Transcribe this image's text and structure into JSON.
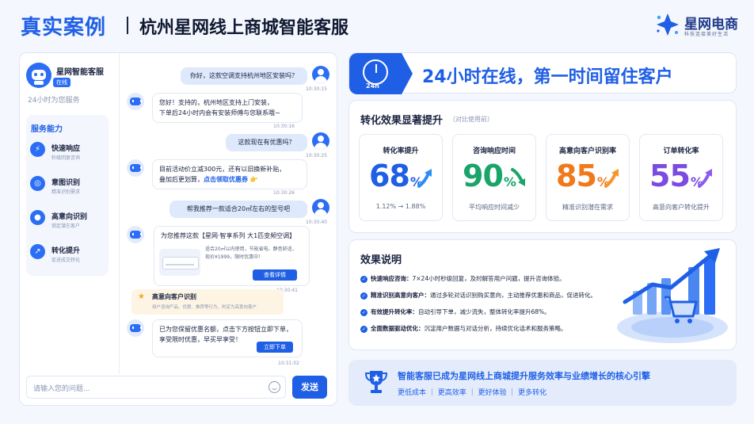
{
  "header": {
    "title_left": "真实案例",
    "title_right": "杭州星网线上商城智能客服"
  },
  "logo": {
    "name": "星网电商",
    "slogan": "科技连接美好生活"
  },
  "chat": {
    "bot_name": "星网智能客服",
    "status": "在线",
    "service_note": "24小时为您服务",
    "abilities_title": "服务能力",
    "abilities": [
      {
        "name": "快速响应",
        "desc": "秒级回复咨询",
        "icon": "lightning-icon"
      },
      {
        "name": "意图识别",
        "desc": "精准识别需求",
        "icon": "target-icon"
      },
      {
        "name": "高意向识别",
        "desc": "锁定潜在客户",
        "icon": "user-icon"
      },
      {
        "name": "转化提升",
        "desc": "促进成交转化",
        "icon": "growth-chart-icon"
      }
    ],
    "messages": {
      "m1": {
        "text": "你好，这款空调支持杭州地区安装吗？",
        "time": "10:30:15"
      },
      "m2": {
        "line1": "您好！支持的，杭州地区支持上门安装，",
        "line2": "下单后24小时内会有安装师傅与您联系哦~",
        "time": "10:30:16"
      },
      "m3": {
        "text": "这款现在有优惠吗？",
        "time": "10:30:25"
      },
      "m4": {
        "line1": "目前活动价立减300元，还有以旧换新补贴，",
        "line2_pre": "叠加后更划算，",
        "line2_link": "点击领取优惠券",
        "emoji": "👉",
        "time": "10:30:26"
      },
      "m5": {
        "text": "帮我推荐一款适合20㎡左右的型号吧",
        "time": "10:30:40"
      },
      "m6": {
        "title": "为您推荐这款【星网·智享系列 大1匹变频空调】",
        "desc1": "适合20㎡以内使用，节能省电、静音舒适，",
        "desc2": "现价¥1999，限时优惠中！",
        "button": "查看详情",
        "time": "10:30:41"
      },
      "alert": {
        "title": "高意向客户识别",
        "desc": "用户咨询产品、优惠、推荐等行为，判定为高意向客户"
      },
      "m7": {
        "line1": "已为您保留优惠名额，点击下方按钮立即下单，",
        "line2": "享受限时优惠，早买早享受！",
        "button": "立即下单",
        "time": "10:31:02"
      }
    },
    "input_placeholder": "请输入您的问题...",
    "send_label": "发送"
  },
  "banner": {
    "text": "24小时在线，第一时间留住客户",
    "badge": "24h"
  },
  "stats": {
    "title": "转化效果显著提升",
    "subtitle": "（对比使用前）",
    "cards": [
      {
        "name": "转化率提升",
        "value": "68",
        "unit": "%",
        "desc": "1.12%  →  1.88%",
        "color": "#1f5fe6"
      },
      {
        "name": "咨询响应时间",
        "value": "90",
        "unit": "%",
        "desc": "平均响应时间减少",
        "color": "#1aa46a"
      },
      {
        "name": "高意向客户识别率",
        "value": "85",
        "unit": "%",
        "desc": "精准识别潜在需求",
        "color": "#f07a1a"
      },
      {
        "name": "订单转化率",
        "value": "55",
        "unit": "%",
        "desc": "高意向客户转化提升",
        "color": "#7b4ce0"
      }
    ]
  },
  "effects": {
    "title": "效果说明",
    "items": [
      {
        "bold": "快速响应咨询：",
        "text": "7×24小时秒级回复，及时解答用户问题，提升咨询体验。"
      },
      {
        "bold": "精准识别高意向客户：",
        "text": "通过多轮对话识别购买意向，主动推荐优惠和商品，促进转化。"
      },
      {
        "bold": "有效提升转化率：",
        "text": "自动引导下单，减少流失，整体转化率提升68%。"
      },
      {
        "bold": "全面数据驱动优化：",
        "text": "沉淀用户数据与对话分析，持续优化话术和服务策略。"
      }
    ]
  },
  "footer": {
    "title": "智能客服已成为星网线上商城提升服务效率与业绩增长的核心引擎",
    "tags": "更低成本 ｜ 更高效率 ｜ 更好体验 ｜ 更多转化"
  }
}
